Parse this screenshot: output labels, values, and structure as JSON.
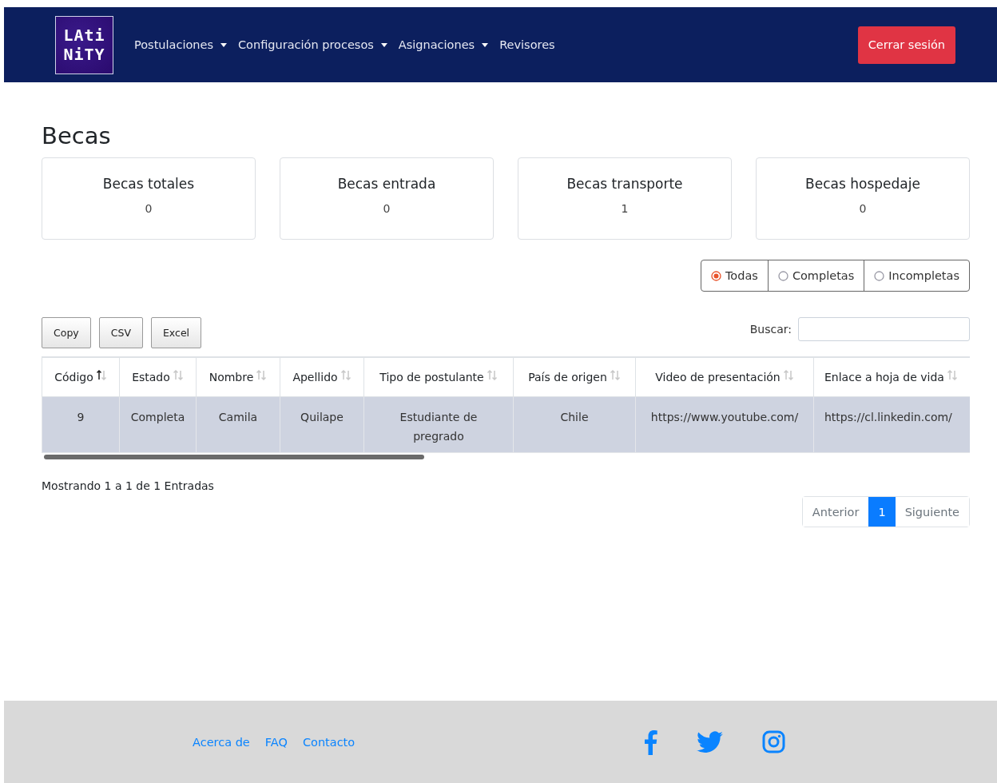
{
  "navbar": {
    "logo": [
      "LAti",
      "NiTY"
    ],
    "menu": [
      {
        "label": "Postulaciones",
        "dropdown": true
      },
      {
        "label": "Configuración procesos",
        "dropdown": true
      },
      {
        "label": "Asignaciones",
        "dropdown": true
      },
      {
        "label": "Revisores",
        "dropdown": false
      }
    ],
    "logout": "Cerrar sesión"
  },
  "title": "Becas",
  "stats": [
    {
      "label": "Becas totales",
      "value": "0"
    },
    {
      "label": "Becas entrada",
      "value": "0"
    },
    {
      "label": "Becas transporte",
      "value": "1"
    },
    {
      "label": "Becas hospedaje",
      "value": "0"
    }
  ],
  "filter": [
    {
      "label": "Todas",
      "selected": true
    },
    {
      "label": "Completas",
      "selected": false
    },
    {
      "label": "Incompletas",
      "selected": false
    }
  ],
  "export_buttons": [
    "Copy",
    "CSV",
    "Excel"
  ],
  "search": {
    "label": "Buscar:"
  },
  "table": {
    "columns": [
      {
        "label": "Código",
        "sorted": true
      },
      {
        "label": "Estado",
        "sorted": false
      },
      {
        "label": "Nombre",
        "sorted": false
      },
      {
        "label": "Apellido",
        "sorted": false
      },
      {
        "label": "Tipo de postulante",
        "sorted": false
      },
      {
        "label": "País de origen",
        "sorted": false
      },
      {
        "label": "Video de presentación",
        "sorted": false
      },
      {
        "label": "Enlace a hoja de vida",
        "sorted": false
      }
    ],
    "rows": [
      {
        "selected": true,
        "cells": [
          "9",
          "Completa",
          "Camila",
          "Quilape",
          "Estudiante de pregrado",
          "Chile",
          "https://www.youtube.com/",
          "https://cl.linkedin.com/"
        ]
      }
    ]
  },
  "info": "Mostrando 1 a 1 de 1 Entradas",
  "pagination": [
    {
      "label": "Anterior",
      "selected": false
    },
    {
      "label": "1",
      "selected": true
    },
    {
      "label": "Siguiente",
      "selected": false
    }
  ],
  "footer": {
    "links": [
      "Acerca de",
      "FAQ",
      "Contacto"
    ],
    "social": [
      {
        "kind": "facebook"
      },
      {
        "kind": "twitter"
      },
      {
        "kind": "instagram"
      }
    ]
  }
}
